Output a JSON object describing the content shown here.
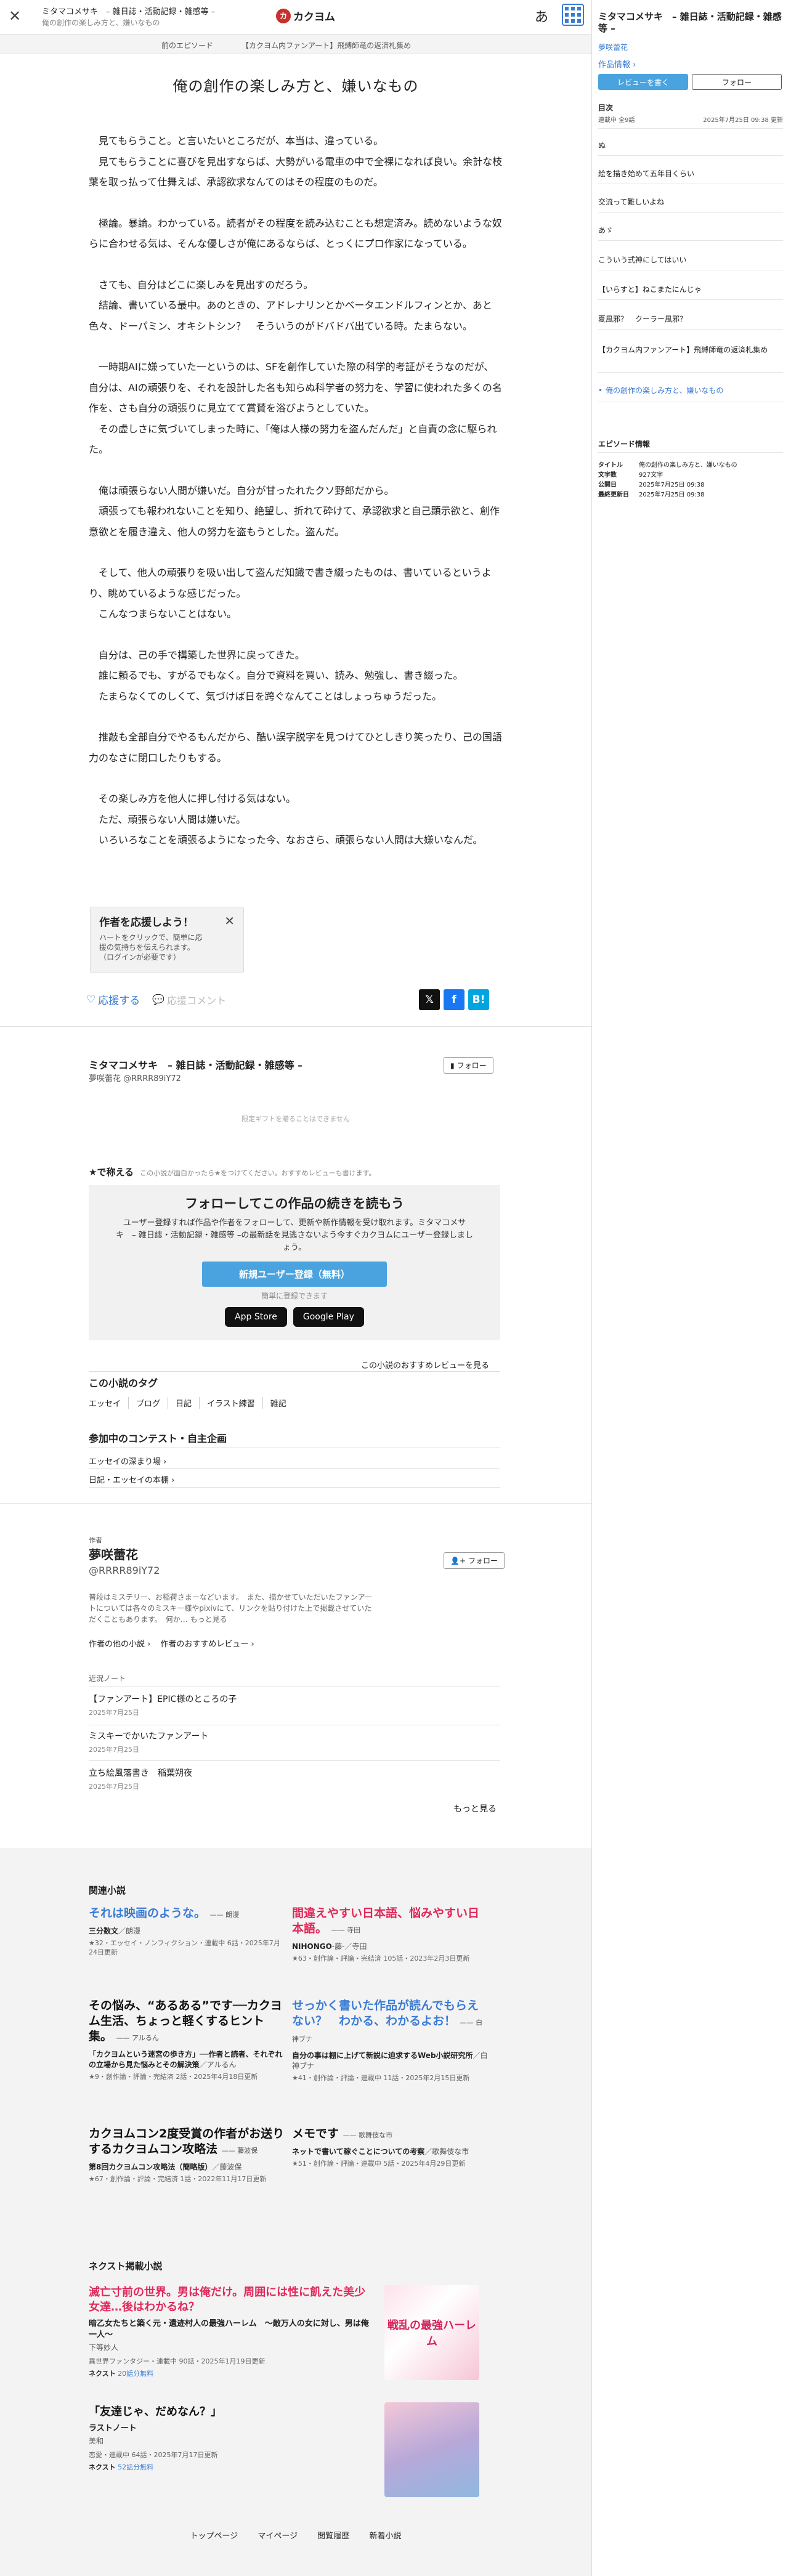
{
  "header": {
    "work_title": "ミタマコメサキ　– 雑日誌・活動記録・雑感等 –",
    "current_episode": "俺の創作の楽しみ方と、嫌いなもの",
    "logo": "カクヨム",
    "logo_mark": "カ",
    "font_toggle": "あ"
  },
  "episode_nav": {
    "prev": "前のエピソード",
    "current": "【カクヨム内ファンアート】飛縛師竜の返済札集め"
  },
  "episode": {
    "title": "俺の創作の楽しみ方と、嫌いなもの",
    "paragraphs": [
      "　見てもらうこと。と言いたいところだが、本当は、違っている。\n　見てもらうことに喜びを見出すならば、大勢がいる電車の中で全裸になれば良い。余計な枝葉を取っ払って仕舞えば、承認欲求なんてのはその程度のものだ。",
      "　極論。暴論。わかっている。読者がその程度を読み込むことも想定済み。読めないような奴らに合わせる気は、そんな優しさが俺にあるならば、とっくにプロ作家になっている。",
      "　さても、自分はどこに楽しみを見出すのだろう。\n　結論、書いている最中。あのときの、アドレナリンとかベータエンドルフィンとか、あと色々、ドーパミン、オキシトシン？　そういうのがドバドバ出ている時。たまらない。",
      "　一時期AIに嫌っていた一というのは、SFを創作していた際の科学的考証がそうなのだが、自分は、AIの頑張りを、それを設計した名も知らぬ科学者の努力を、学習に使われた多くの名作を、さも自分の頑張りに見立てて賞賛を浴びようとしていた。\n　その虚しさに気づいてしまった時に、「俺は人様の努力を盗んだんだ」と自責の念に駆られた。",
      "　俺は頑張らない人間が嫌いだ。自分が甘ったれたクソ野郎だから。\n　頑張っても報われないことを知り、絶望し、折れて砕けて、承認欲求と自己顕示欲と、創作意欲とを履き違え、他人の努力を盗もうとした。盗んだ。",
      "　そして、他人の頑張りを吸い出して盗んだ知識で書き綴ったものは、書いているというより、眺めているような感じだった。\n　こんなつまらないことはない。",
      "　自分は、己の手で構築した世界に戻ってきた。\n　誰に頼るでも、すがるでもなく。自分で資料を買い、読み、勉強し、書き綴った。\n　たまらなくてのしくて、気づけば日を跨ぐなんてことはしょっちゅうだった。",
      "　推敲も全部自分でやるもんだから、酷い誤字脱字を見つけてひとしきり笑ったり、己の国語力のなさに閉口したりもする。",
      "　その楽しみ方を他人に押し付ける気はない。\n　ただ、頑張らない人間は嫌いだ。\n　いろいろなことを頑張るようになった今、なおさら、頑張らない人間は大嫌いなんだ。"
    ]
  },
  "support": {
    "popup_title": "作者を応援しよう！",
    "popup_desc": "ハートをクリックで、簡単に応援の気持ちを伝えられます。（ログインが必要です）",
    "like": "応援する",
    "comment": "応援コメント"
  },
  "share": {
    "x": "𝕏",
    "fb": "f",
    "hatena": "B!"
  },
  "work_block": {
    "title": "ミタマコメサキ　– 雑日誌・活動記録・雑感等 –",
    "author": "夢咲蕾花 @RRRR89iY72",
    "follow": "フォロー",
    "ad_note": "限定ギフトを贈ることはできません"
  },
  "review": {
    "label": "★で称える",
    "hint": "この小説が面白かったら★をつけてください。おすすめレビューも書けます。"
  },
  "signup": {
    "heading": "フォローしてこの作品の続きを読もう",
    "desc": "ユーザー登録すれば作品や作者をフォローして、更新や新作情報を受け取れます。ミタマコメサキ　– 雑日誌・活動記録・雑感等 –の最新話を見逃さないよう今すぐカクヨムにユーザー登録しましょう。",
    "register": "新規ユーザー登録（無料）",
    "easy": "簡単に登録できます",
    "app_store": "App Store",
    "google_play": "Google Play",
    "reviews_link": "この小説のおすすめレビューを見る"
  },
  "tags": {
    "heading": "この小説のタグ",
    "items": [
      "エッセイ",
      "ブログ",
      "日記",
      "イラスト練習",
      "雑記"
    ]
  },
  "contests": {
    "heading": "参加中のコンテスト・自主企画",
    "items": [
      "エッセイの深まり場 ›",
      "日記・エッセイの本棚 ›"
    ]
  },
  "author": {
    "label": "作者",
    "name": "夢咲蕾花",
    "id": "@RRRR89iY72",
    "follow": "フォロー",
    "desc": "普段はミステリー、お稲荷さまーなどいます。　また、描かせていただいたファンアートについては各々のミスキー様やpixivにて、リンクを貼り付けた上で掲載させていただくこともあります。　何か… もっと見る",
    "links": [
      "作者の他の小説 ›",
      "作者のおすすめレビュー ›"
    ],
    "notes_heading": "近況ノート",
    "notes": [
      {
        "title": "【ファンアート】EPIC様のところの子",
        "date": "2025年7月25日"
      },
      {
        "title": "ミスキーでかいたファンアート",
        "date": "2025年7月25日"
      },
      {
        "title": "立ち絵風落書き　稲葉朔夜",
        "date": "2025年7月25日"
      }
    ],
    "more": "もっと見る"
  },
  "related": {
    "heading": "関連小説",
    "items": [
      {
        "title": "それは映画のような。",
        "by": "—— 朗漫",
        "sub": "三分数文",
        "by2": "／朗漫",
        "meta": "★32・エッセイ・ノンフィクション・連載中 6話・2025年7月24日更新"
      },
      {
        "title": "間違えやすい日本語、悩みやすい日本語。",
        "by": "—— 寺田",
        "sub": "NIHONGO",
        "by2": "-藤-／寺田",
        "meta": "★63・創作論・評論・完結済 105話・2023年2月3日更新"
      },
      {
        "title": "その悩み、“あるある”です──カクヨム生活、ちょっと軽くするヒント集。",
        "by": "—— アルるん",
        "sub": "「カクヨムという迷宮の歩き方」──作者と読者、それぞれの立場から見た悩みとその解決策",
        "by2": "／アルるん",
        "meta": "★9・創作論・評論・完結済 2話・2025年4月18日更新"
      },
      {
        "title": "せっかく書いた作品が読んでもらえない？　わかる、わかるよお！",
        "by": "—— 白神ブナ",
        "sub": "自分の事は棚に上げて新説に迫求するWeb小説研究所",
        "by2": "／白神ブナ",
        "meta": "★41・創作論・評論・連載中 11話・2025年2月15日更新"
      },
      {
        "title": "カクヨムコン2度受賞の作者がお送りするカクヨムコン攻略法",
        "by": "—— 藤波保",
        "sub": "第8回カクヨムコン攻略法（簡略版）",
        "by2": "／藤波保",
        "meta": "★67・創作論・評論・完結済 1話・2022年11月17日更新"
      },
      {
        "title": "メモです",
        "by": "—— 歌舞伎な市",
        "sub": "ネットで書いて稼ぐことについての考察",
        "by2": "／歌舞伎な市",
        "meta": "★51・創作論・評論・連載中 5話・2025年4月29日更新"
      }
    ]
  },
  "next_works": {
    "heading": "ネクスト掲載小説",
    "items": [
      {
        "title": "滅亡寸前の世界。男は俺だけ。周囲には性に飢えた美少女達…後はわかるね？",
        "sub": "暗乙女たちと築く元・遺迹村人の最強ハーレム　〜敵万人の女に対し、男は俺一人〜",
        "author": "下等妙人",
        "meta": "異世界ファンタジー・連載中 90話・2025年1月19日更新",
        "badge": "ネクスト",
        "badge_sub": "20話分無料",
        "cover_text": "戦乱の最強ハーレム"
      },
      {
        "title": "「友達じゃ、だめなん？」",
        "sub": "ラストノート",
        "author": "美和",
        "meta": "恋愛・連載中 64話・2025年7月17日更新",
        "badge": "ネクスト",
        "badge_sub": "52話分無料",
        "cover_text": ""
      }
    ]
  },
  "footer": {
    "links": [
      "トップページ",
      "マイページ",
      "閲覧履歴",
      "新着小説"
    ]
  },
  "sidebar": {
    "work_title": "ミタマコメサキ　– 雑日誌・活動記録・雑感等 –",
    "author": "夢咲蕾花",
    "info": "作品情報 ›",
    "read_review": "レビューを書く",
    "follow": "フォロー",
    "toc": "目次",
    "status": "連載中 全9話",
    "updated": "2025年7月25日 09:38 更新",
    "episodes": [
      "ぬ",
      "絵を描き始めて五年目くらい",
      "交流って難しいよね",
      "あゞ",
      "こういう式神にしてはいい",
      "【いらすと】ねこまたにんじゃ",
      "夏風邪？　クーラー風邪？",
      "【カクヨム内ファンアート】飛縛師竜の返済札集め",
      "俺の創作の楽しみ方と、嫌いなもの"
    ],
    "episode_info": {
      "heading": "エピソード情報",
      "rows": [
        {
          "k": "タイトル",
          "v": "俺の創作の楽しみ方と、嫌いなもの"
        },
        {
          "k": "文字数",
          "v": "927文字"
        },
        {
          "k": "公開日",
          "v": "2025年7月25日 09:38"
        },
        {
          "k": "最終更新日",
          "v": "2025年7月25日 09:38"
        }
      ]
    }
  },
  "colors": {
    "accent": "#3a7bd5",
    "pink": "#e1285a",
    "logo": "#c8302c",
    "button": "#4aa3df"
  }
}
